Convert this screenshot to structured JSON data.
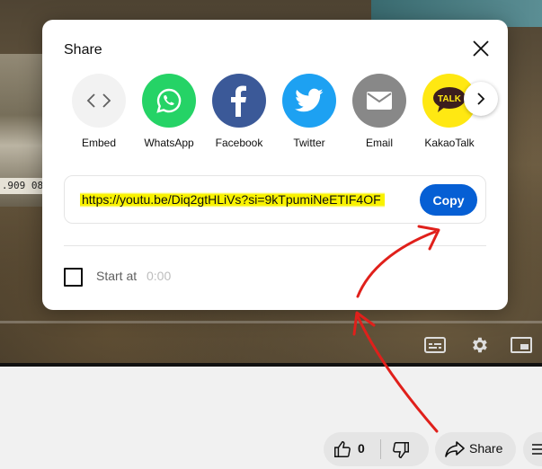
{
  "video": {
    "plate_text": ".909 08"
  },
  "dialog": {
    "title": "Share",
    "share_targets": [
      {
        "name": "embed",
        "label": "Embed",
        "color": "#f2f2f2",
        "icon": "embed-icon"
      },
      {
        "name": "whatsapp",
        "label": "WhatsApp",
        "color": "#25d366",
        "icon": "whatsapp-icon"
      },
      {
        "name": "facebook",
        "label": "Facebook",
        "color": "#3b5998",
        "icon": "facebook-icon"
      },
      {
        "name": "twitter",
        "label": "Twitter",
        "color": "#1da1f2",
        "icon": "twitter-icon"
      },
      {
        "name": "email",
        "label": "Email",
        "color": "#888888",
        "icon": "email-icon"
      },
      {
        "name": "kakaotalk",
        "label": "KakaoTalk",
        "color": "#ffe812",
        "icon": "kakaotalk-icon",
        "badge": "TALK"
      }
    ],
    "url": "https://youtu.be/Diq2gtHLiVs?si=9kTpumiNeETIF4OF",
    "copy_label": "Copy",
    "start_at_label": "Start at",
    "start_at_time": "0:00",
    "start_at_checked": false
  },
  "actions": {
    "like_count": "0",
    "share_label": "Share"
  },
  "colors": {
    "accent": "#065fd4",
    "highlight": "#f9f200",
    "annotation_arrow": "#e0201b"
  }
}
